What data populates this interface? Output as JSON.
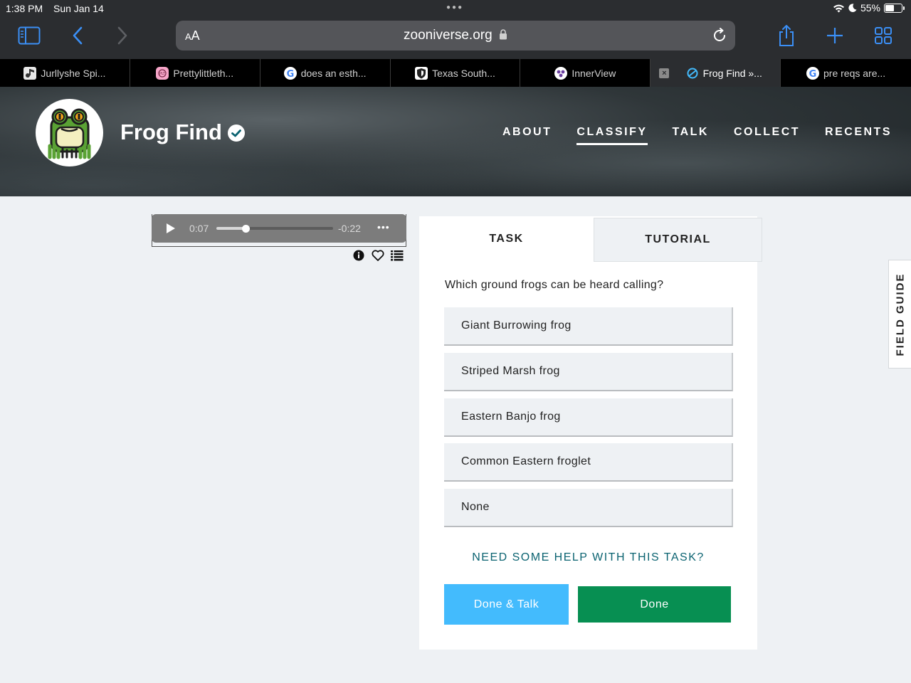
{
  "status_bar": {
    "time": "1:38 PM",
    "date": "Sun Jan 14",
    "battery_percent": "55%",
    "battery_level": 0.55
  },
  "browser": {
    "text_size_label": "AA",
    "url": "zooniverse.org",
    "accent_color": "#3b8ff5",
    "tabs": [
      {
        "title": "Jurllyshe Spi...",
        "favicon": "music-icon",
        "active": false
      },
      {
        "title": "Prettylittleth...",
        "favicon": "plt-icon",
        "active": false
      },
      {
        "title": "does an esth...",
        "favicon": "google-icon",
        "active": false
      },
      {
        "title": "Texas South...",
        "favicon": "shield-crest-icon",
        "active": false
      },
      {
        "title": "InnerView",
        "favicon": "innerview-icon",
        "active": false
      },
      {
        "title": "Frog Find »...",
        "favicon": "zooniverse-icon",
        "active": true
      },
      {
        "title": "pre reqs are...",
        "favicon": "google-icon",
        "active": false
      }
    ]
  },
  "site": {
    "project_title": "Frog Find",
    "nav": [
      {
        "label": "ABOUT",
        "active": false
      },
      {
        "label": "CLASSIFY",
        "active": true
      },
      {
        "label": "TALK",
        "active": false
      },
      {
        "label": "COLLECT",
        "active": false
      },
      {
        "label": "RECENTS",
        "active": false
      }
    ]
  },
  "audio": {
    "elapsed": "0:07",
    "remaining": "-0:22",
    "progress_fraction": 0.24
  },
  "task_panel": {
    "tab_task": "TASK",
    "tab_tutorial": "TUTORIAL",
    "question": "Which ground frogs can be heard calling?",
    "answers": [
      "Giant Burrowing frog",
      "Striped Marsh frog",
      "Eastern Banjo frog",
      "Common Eastern froglet",
      "None"
    ],
    "help_link": "NEED SOME HELP WITH THIS TASK?",
    "done_talk_button": "Done & Talk",
    "done_button": "Done"
  },
  "field_guide_label": "FIELD GUIDE",
  "colors": {
    "done_talk": "#43bbfd",
    "done": "#078f52",
    "help_link": "#0b6371",
    "verified": "#0b6371"
  }
}
